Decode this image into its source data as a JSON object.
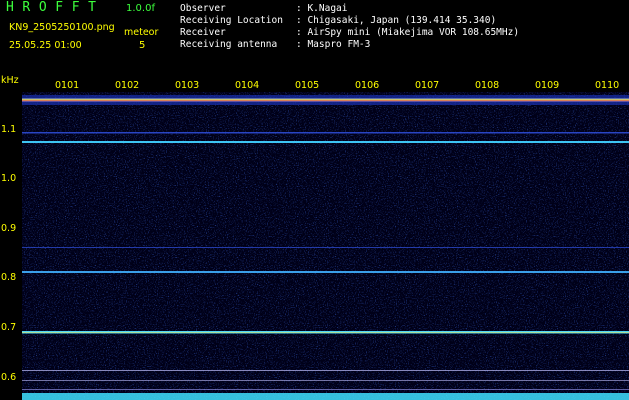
{
  "header": {
    "app_title": "HROFFT",
    "version": "1.0.0f",
    "file_name": "KN9_2505250100.png",
    "datetime": "25.05.25 01:00",
    "meteor_label": "meteor",
    "meteor_count": "5"
  },
  "station_info": [
    {
      "label": "Observer",
      "value": ": K.Nagai"
    },
    {
      "label": "Receiving Location",
      "value": ": Chigasaki, Japan (139.414 35.340)"
    },
    {
      "label": "Receiver",
      "value": ": AirSpy mini (Miakejima VOR 108.65MHz)"
    },
    {
      "label": "Receiving antenna",
      "value": ": Maspro FM-3"
    }
  ],
  "plot": {
    "freq_unit": "kHz",
    "time_ticks": [
      "0101",
      "0102",
      "0103",
      "0104",
      "0105",
      "0106",
      "0107",
      "0108",
      "0109",
      "0110"
    ],
    "freq_ticks": [
      "1.1",
      "1.0",
      "0.9",
      "0.8",
      "0.7",
      "0.6"
    ],
    "colors": {
      "background": "#000018",
      "noise_dark": "#0b1a6e",
      "noise_mid": "#2440c8",
      "carrier_strong": "#e8e860",
      "carrier_mid": "#40d0ff",
      "carrier_weak": "#3050e0",
      "label": "#ffff00",
      "title": "#3cff3c"
    }
  }
}
